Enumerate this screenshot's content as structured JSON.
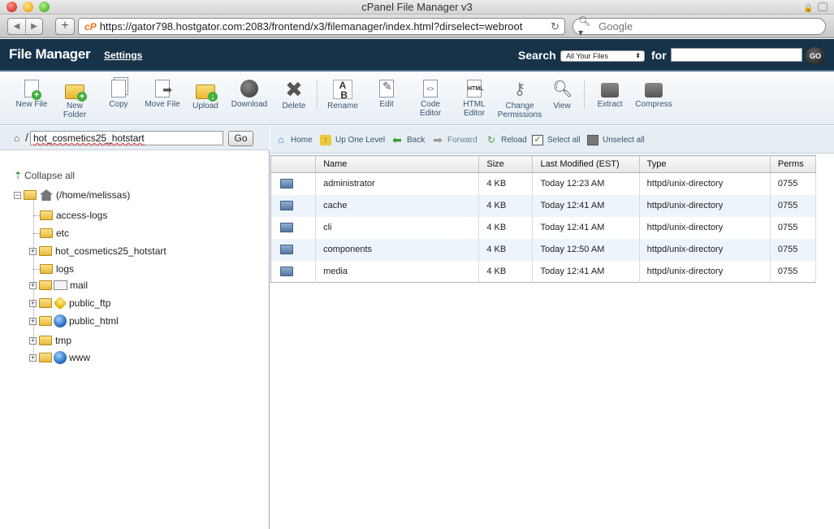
{
  "window": {
    "title": "cPanel File Manager v3"
  },
  "browser": {
    "url": "https://gator798.hostgator.com:2083/frontend/x3/filemanager/index.html?dirselect=webroot",
    "search_placeholder": "Google",
    "site_badge": "cP"
  },
  "header": {
    "title": "File Manager",
    "settings": "Settings",
    "search_label": "Search",
    "search_scope": "All Your Files",
    "for_label": "for",
    "go_label": "GO"
  },
  "toolbar": [
    {
      "label": "New File"
    },
    {
      "label": "New Folder"
    },
    {
      "label": "Copy"
    },
    {
      "label": "Move File"
    },
    {
      "label": "Upload"
    },
    {
      "label": "Download"
    },
    {
      "label": "Delete"
    },
    {
      "label": "Rename"
    },
    {
      "label": "Edit"
    },
    {
      "label": "Code Editor"
    },
    {
      "label": "HTML Editor"
    },
    {
      "label": "Change Permissions"
    },
    {
      "label": "View"
    },
    {
      "label": "Extract"
    },
    {
      "label": "Compress"
    }
  ],
  "pathbar": {
    "path": "hot_cosmetics25_hotstart",
    "go": "Go"
  },
  "tree": {
    "collapse_all": "Collapse all",
    "root": "(/home/melissas)",
    "items": [
      {
        "label": "access-logs"
      },
      {
        "label": "etc"
      },
      {
        "label": "hot_cosmetics25_hotstart"
      },
      {
        "label": "logs"
      },
      {
        "label": "mail"
      },
      {
        "label": "public_ftp"
      },
      {
        "label": "public_html"
      },
      {
        "label": "tmp"
      },
      {
        "label": "www"
      }
    ]
  },
  "actions": {
    "home": "Home",
    "up": "Up One Level",
    "back": "Back",
    "forward": "Forward",
    "reload": "Reload",
    "select_all": "Select all",
    "unselect_all": "Unselect all"
  },
  "table": {
    "columns": [
      "Name",
      "Size",
      "Last Modified (EST)",
      "Type",
      "Perms"
    ],
    "rows": [
      {
        "name": "administrator",
        "size": "4 KB",
        "modified": "Today 12:23 AM",
        "type": "httpd/unix-directory",
        "perms": "0755"
      },
      {
        "name": "cache",
        "size": "4 KB",
        "modified": "Today 12:41 AM",
        "type": "httpd/unix-directory",
        "perms": "0755"
      },
      {
        "name": "cli",
        "size": "4 KB",
        "modified": "Today 12:41 AM",
        "type": "httpd/unix-directory",
        "perms": "0755"
      },
      {
        "name": "components",
        "size": "4 KB",
        "modified": "Today 12:50 AM",
        "type": "httpd/unix-directory",
        "perms": "0755"
      },
      {
        "name": "media",
        "size": "4 KB",
        "modified": "Today 12:41 AM",
        "type": "httpd/unix-directory",
        "perms": "0755"
      }
    ]
  },
  "colors": {
    "header_bg": "#16334a",
    "link": "#3a5470",
    "row_alt": "#eef4fb"
  }
}
